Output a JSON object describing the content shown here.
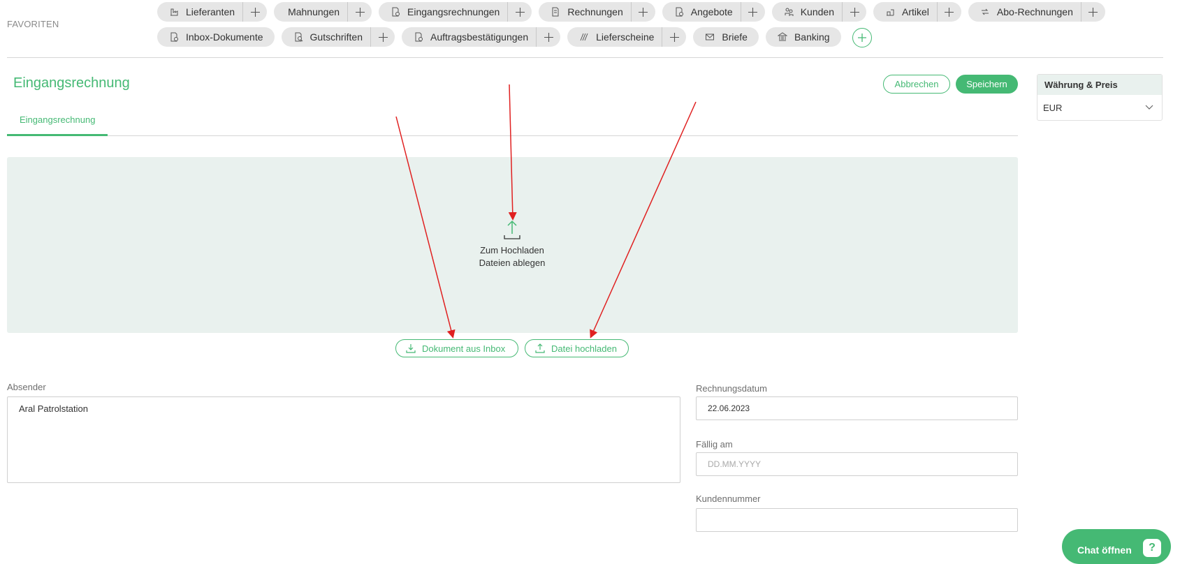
{
  "favorites": {
    "label": "FAVORITEN",
    "row1": [
      {
        "label": "Lieferanten",
        "icon": "supplier-icon",
        "has_add": true
      },
      {
        "label": "Mahnungen",
        "icon": "",
        "has_add": true
      },
      {
        "label": "Eingangsrechnungen",
        "icon": "incoming-invoice-icon",
        "has_add": true
      },
      {
        "label": "Rechnungen",
        "icon": "invoice-icon",
        "has_add": true
      },
      {
        "label": "Angebote",
        "icon": "offer-icon",
        "has_add": true
      },
      {
        "label": "Kunden",
        "icon": "customers-icon",
        "has_add": true
      },
      {
        "label": "Artikel",
        "icon": "article-icon",
        "has_add": true
      },
      {
        "label": "Abo-Rechnungen",
        "icon": "subscription-icon",
        "has_add": true
      }
    ],
    "row2": [
      {
        "label": "Inbox-Dokumente",
        "icon": "inbox-document-icon",
        "has_add": false
      },
      {
        "label": "Gutschriften",
        "icon": "credit-note-icon",
        "has_add": true
      },
      {
        "label": "Auftragsbestätigungen",
        "icon": "order-confirmation-icon",
        "has_add": true
      },
      {
        "label": "Lieferscheine",
        "icon": "delivery-note-icon",
        "has_add": true
      },
      {
        "label": "Briefe",
        "icon": "mail-icon",
        "has_add": false
      },
      {
        "label": "Banking",
        "icon": "bank-icon",
        "has_add": false
      }
    ]
  },
  "page": {
    "title": "Eingangsrechnung",
    "cancel_label": "Abbrechen",
    "save_label": "Speichern",
    "tab_label": "Eingangsrechnung"
  },
  "dropzone": {
    "line1": "Zum Hochladen",
    "line2": "Dateien ablegen",
    "inbox_button": "Dokument aus Inbox",
    "upload_button": "Datei hochladen"
  },
  "form": {
    "absender_label": "Absender",
    "absender_value": "Aral Patrolstation",
    "date_label": "Rechnungsdatum",
    "date_value": "22.06.2023",
    "due_label": "Fällig am",
    "due_placeholder": "DD.MM.YYYY",
    "customer_label": "Kundennummer",
    "customer_value": ""
  },
  "panel": {
    "title": "Währung & Preis",
    "currency": "EUR"
  },
  "chat": {
    "label": "Chat öffnen",
    "badge": "?"
  },
  "colors": {
    "accent": "#45b974",
    "dropzone_bg": "#e9f1ee",
    "annotation_arrow": "#e02020"
  }
}
